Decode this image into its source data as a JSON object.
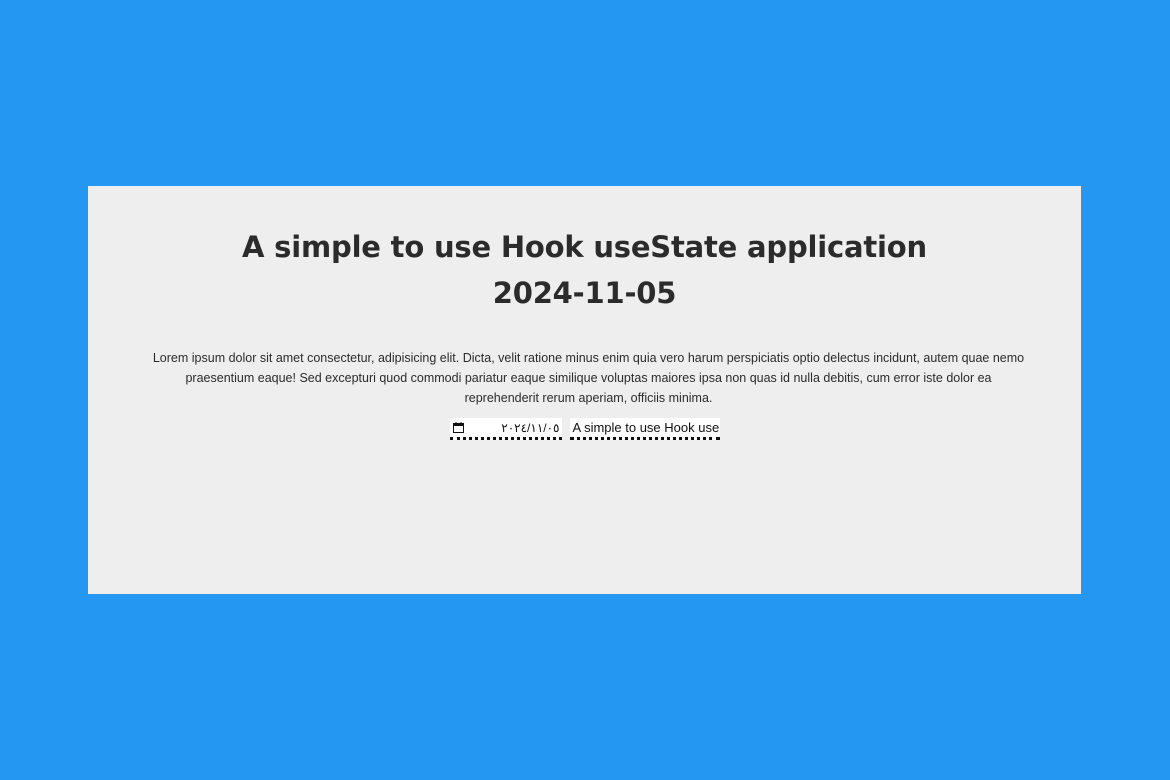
{
  "header": {
    "title": "A simple to use Hook useState application",
    "date": "2024-11-05"
  },
  "content": {
    "description": "Lorem ipsum dolor sit amet consectetur, adipisicing elit. Dicta, velit ratione minus enim quia vero harum perspiciatis optio delectus incidunt, autem quae nemo praesentium eaque! Sed excepturi quod commodi pariatur eaque similique voluptas maiores ipsa non quas id nulla debitis, cum error iste dolor ea reprehenderit rerum aperiam, officiis minima."
  },
  "form": {
    "date_input": {
      "value": "٢٠٢٤/١١/٠٥",
      "icon": "calendar-icon"
    },
    "title_input": {
      "value": "A simple to use Hook useState application"
    }
  },
  "colors": {
    "background": "#2497f2",
    "card": "#eeeeee",
    "text": "#2b2b2b"
  }
}
